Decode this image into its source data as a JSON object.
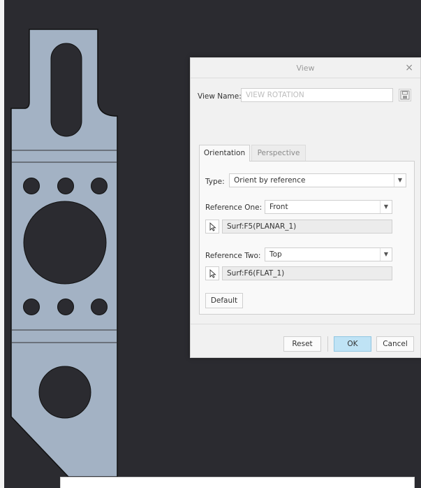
{
  "dialog": {
    "title": "View",
    "close_glyph": "×",
    "view_name_label": "View Name:",
    "view_name_value": "VIEW ROTATION",
    "save_icon": "floppy-disk-icon",
    "tabs": [
      {
        "label": "Orientation",
        "active": true
      },
      {
        "label": "Perspective",
        "active": false
      }
    ],
    "type_label": "Type:",
    "type_value": "Orient by reference",
    "ref_one_label": "Reference One:",
    "ref_one_value": "Front",
    "ref_one_surface": "Surf:F5(PLANAR_1)",
    "ref_two_label": "Reference Two:",
    "ref_two_value": "Top",
    "ref_two_surface": "Surf:F6(FLAT_1)",
    "default_label": "Default",
    "reset_label": "Reset",
    "ok_label": "OK",
    "cancel_label": "Cancel",
    "pick_icon": "cursor-arrow-icon",
    "dropdown_icon": "chevron-down-icon"
  },
  "colors": {
    "background": "#2b2b30",
    "part_fill": "#a3b2c4",
    "ok_accent": "#bfe3f5"
  }
}
